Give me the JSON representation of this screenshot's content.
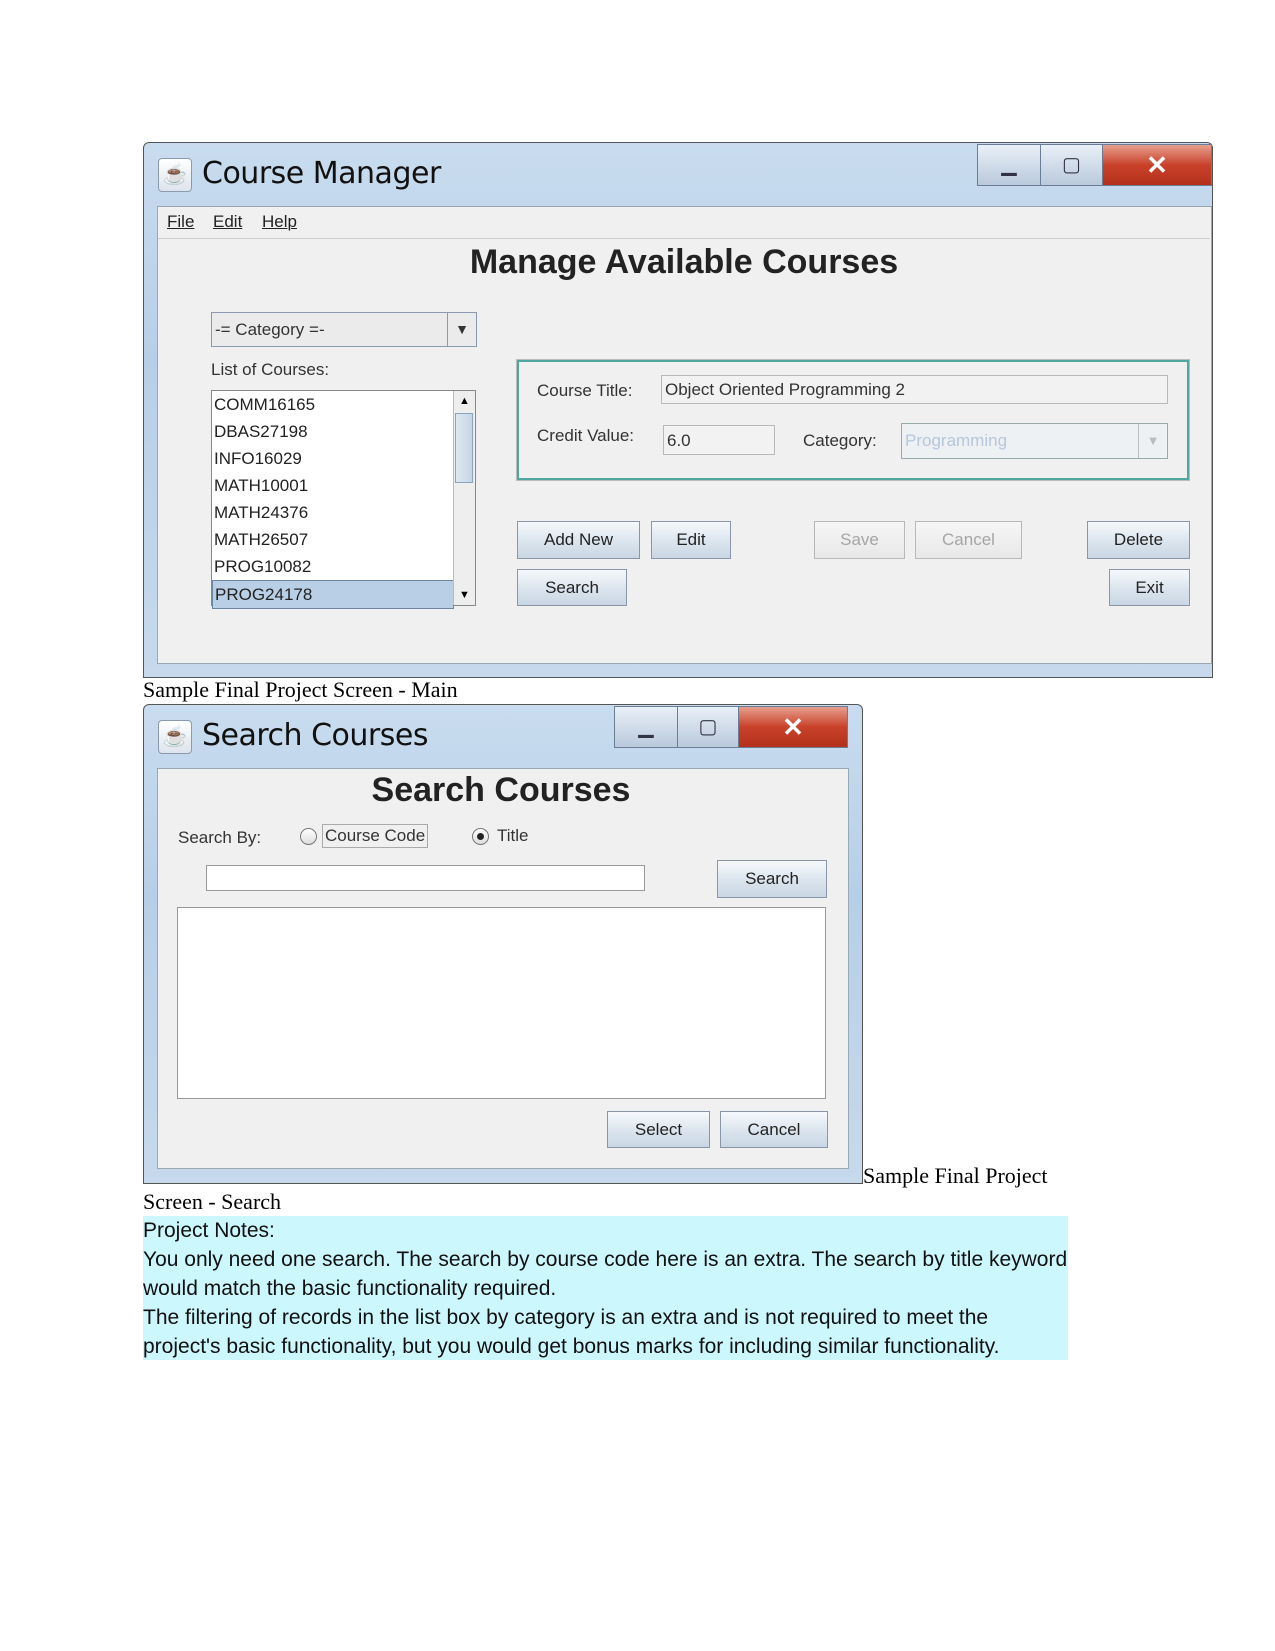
{
  "main_window": {
    "title": "Course Manager",
    "icon": "java-icon",
    "menu": [
      "File",
      "Edit",
      "Help"
    ],
    "heading": "Manage Available Courses",
    "category_filter": "-= Category =-",
    "list_label": "List of Courses:",
    "courses": [
      "COMM16165",
      "DBAS27198",
      "INFO16029",
      "MATH10001",
      "MATH24376",
      "MATH26507",
      "PROG10082",
      "PROG24178"
    ],
    "selected_course": "PROG24178",
    "course_title_label": "Course Title:",
    "course_title": "Object Oriented Programming 2",
    "credit_label": "Credit Value:",
    "credit_value": "6.0",
    "category_label": "Category:",
    "category_value": "Programming",
    "buttons": {
      "add_new": "Add New",
      "edit": "Edit",
      "save": "Save",
      "cancel": "Cancel",
      "delete": "Delete",
      "search": "Search",
      "exit": "Exit"
    }
  },
  "caption_main": "Sample Final Project Screen - Main",
  "search_window": {
    "title": "Search Courses",
    "icon": "java-icon",
    "heading": "Search Courses",
    "search_by_label": "Search By:",
    "option_code": "Course Code",
    "option_title": "Title",
    "selected_option": "Title",
    "search_value": "",
    "buttons": {
      "search": "Search",
      "select": "Select",
      "cancel": "Cancel"
    }
  },
  "caption_search_1": "Sample Final Project",
  "caption_search_2": "Screen - Search",
  "notes": {
    "title": "Project Notes:",
    "line1": "You only need one search. The search by course code here is an extra. The search by title keyword would match the basic functionality required.",
    "line2": "The filtering of records in the list box by category is an extra and is not required to meet the project's basic functionality, but you would get bonus marks for including similar functionality."
  },
  "colors": {
    "selection": "#b8cfe5",
    "panel_border": "#4fa7a0",
    "notes_bg": "#ccf7fd",
    "close_button": "#c9422b"
  }
}
